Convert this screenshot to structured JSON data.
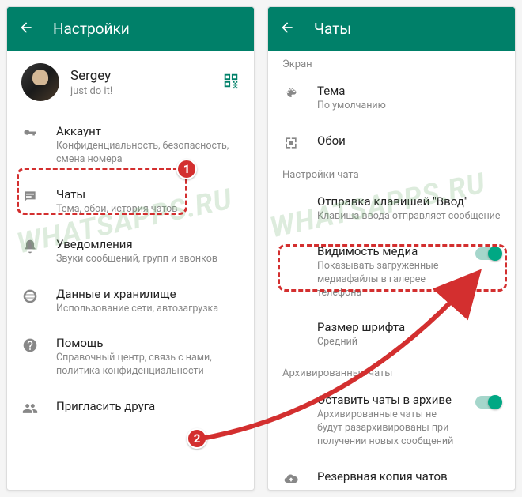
{
  "watermark": "WHATSAPPS.RU",
  "left": {
    "header_title": "Настройки",
    "profile": {
      "name": "Sergey",
      "status": "just do it!"
    },
    "items": [
      {
        "icon": "key",
        "title": "Аккаунт",
        "sub": "Конфиденциальность, безопасность, смена номера"
      },
      {
        "icon": "chat",
        "title": "Чаты",
        "sub": "Тема, обои, история чатов"
      },
      {
        "icon": "bell",
        "title": "Уведомления",
        "sub": "Звуки сообщений, групп и звонков"
      },
      {
        "icon": "data",
        "title": "Данные и хранилище",
        "sub": "Использование сети, автозагрузка"
      },
      {
        "icon": "help",
        "title": "Помощь",
        "sub": "Справочный центр, связь с нами, политика конфиденциальности"
      },
      {
        "icon": "invite",
        "title": "Пригласить друга",
        "sub": ""
      }
    ]
  },
  "right": {
    "header_title": "Чаты",
    "section_screen": "Экран",
    "theme": {
      "title": "Тема",
      "sub": "По умолчанию"
    },
    "wallpaper": {
      "title": "Обои"
    },
    "section_chat": "Настройки чата",
    "enter_send": {
      "title": "Отправка клавишей \"Ввод\"",
      "sub": "Клавиша ввода отправляет сообщение"
    },
    "media_vis": {
      "title": "Видимость медиа",
      "sub": "Показывать загруженные медиафайлы в галерее телефона"
    },
    "font_size": {
      "title": "Размер шрифта",
      "sub": "Средний"
    },
    "section_arch": "Архивированные чаты",
    "keep_arch": {
      "title": "Оставить чаты в архиве",
      "sub": "Архивированные чаты не будут разархивированы при получении новых сообщений"
    },
    "backup": {
      "title": "Резервная копия чатов"
    }
  },
  "annotations": {
    "badge1": "1",
    "badge2": "2"
  }
}
